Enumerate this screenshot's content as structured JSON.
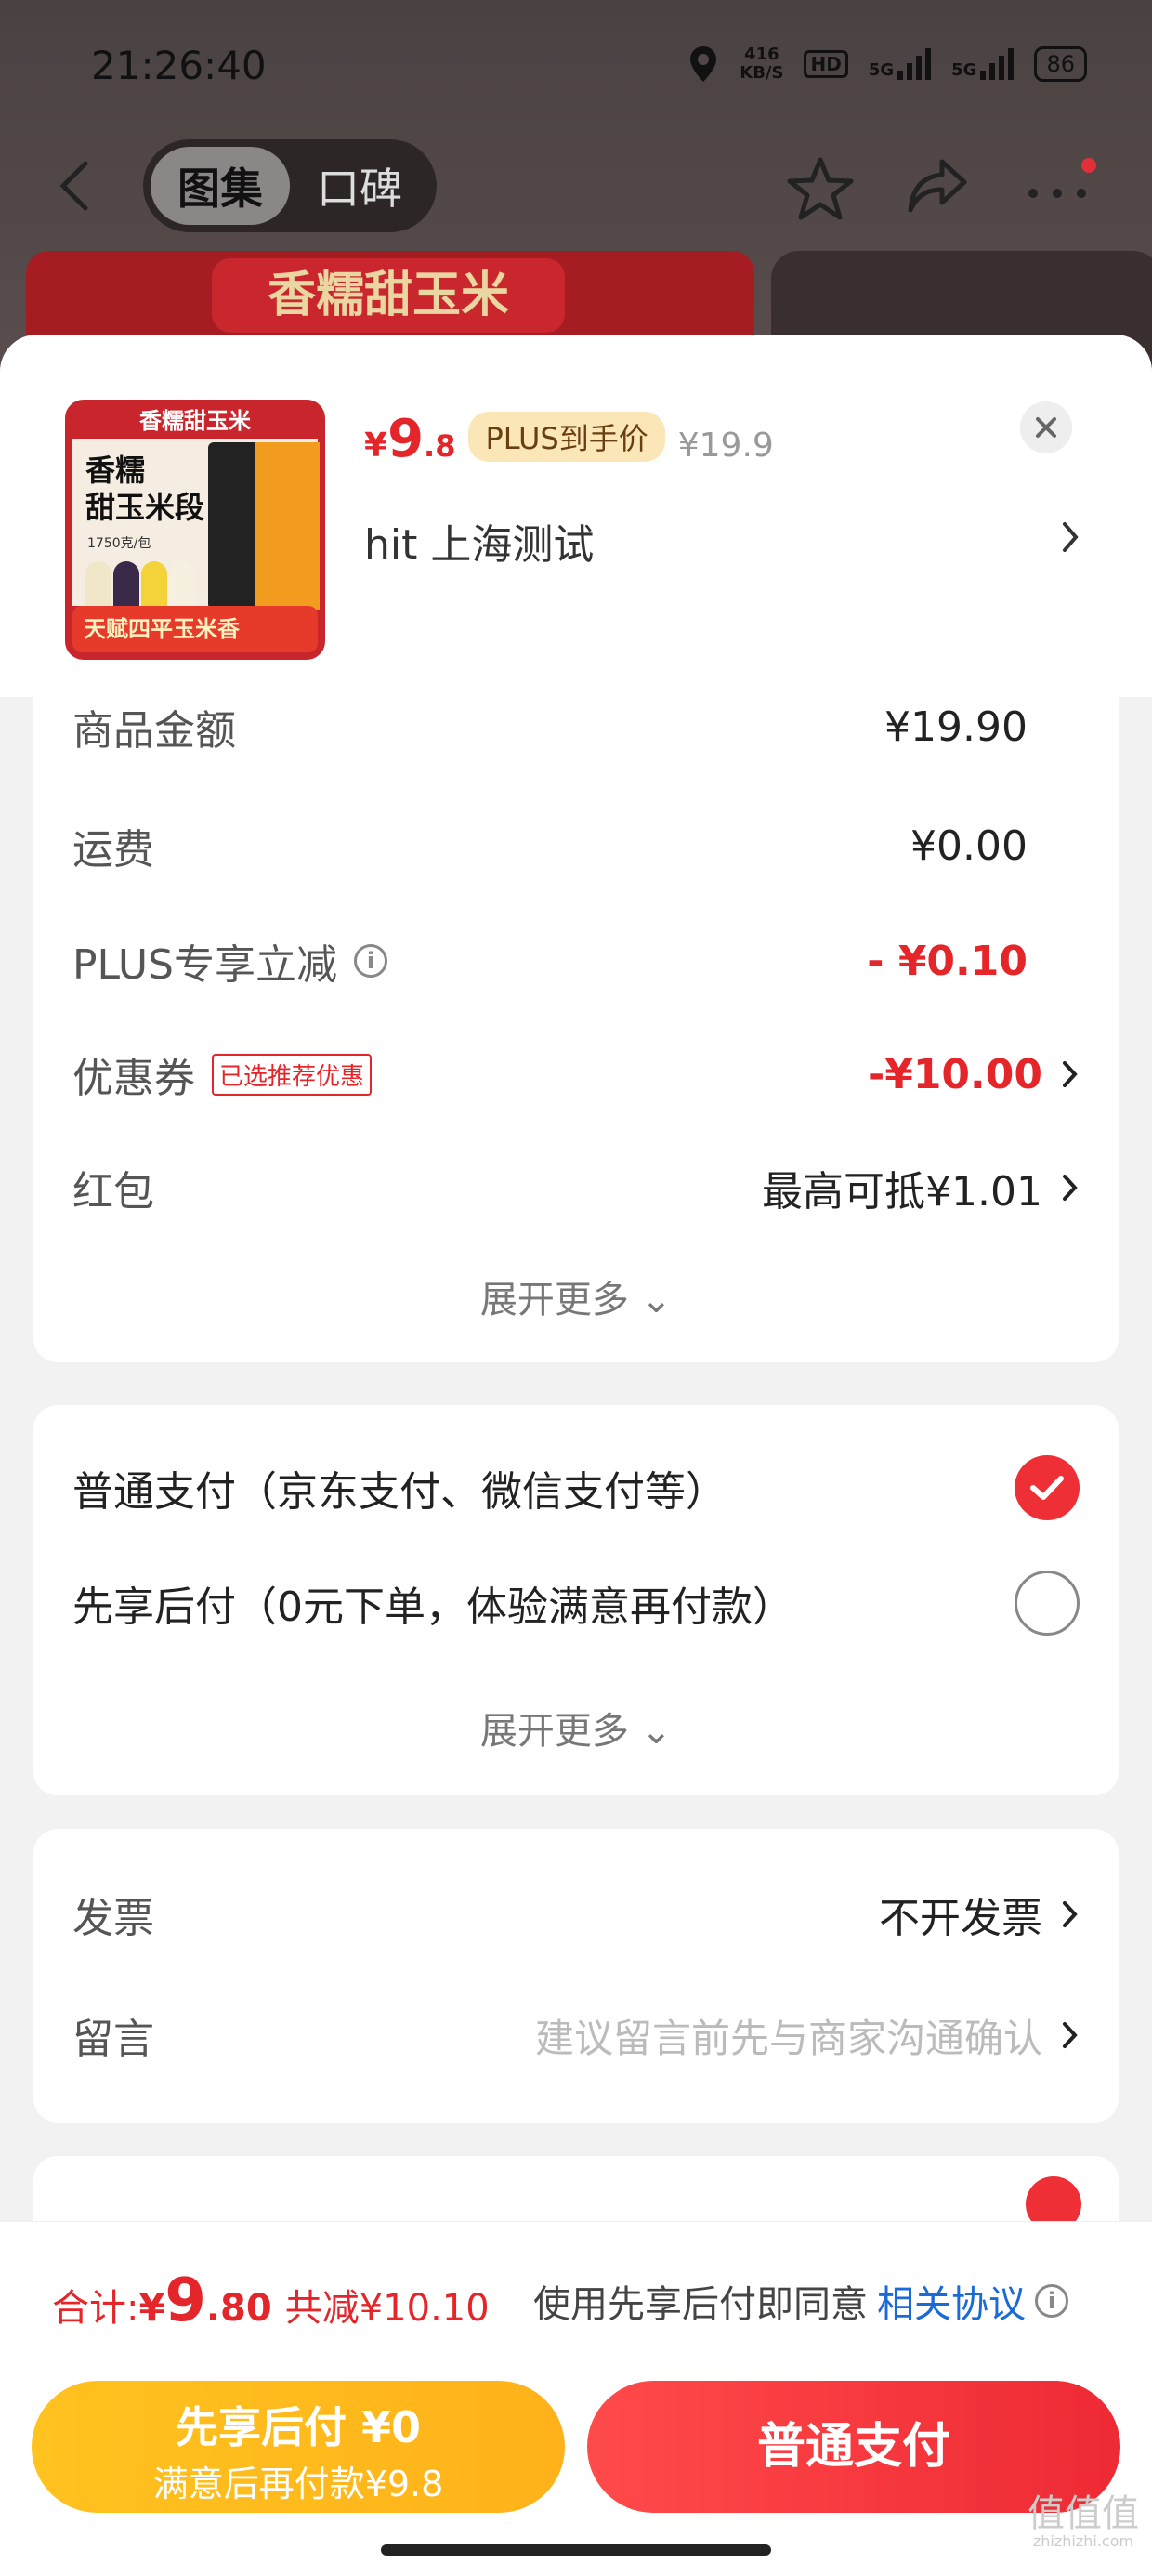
{
  "status_bar": {
    "time": "21:26:40",
    "net_speed": "416",
    "net_unit": "KB/S",
    "hd": "HD",
    "sig1": "5G",
    "sig2": "5G",
    "battery": "86"
  },
  "nav": {
    "tab_active": "图集",
    "tab_inactive": "口碑"
  },
  "background": {
    "banner_title": "香糯甜玉米"
  },
  "product": {
    "thumb_top": "香糯甜玉米",
    "thumb_name": "香糯\n甜玉米段",
    "thumb_spec": "1750克/包",
    "thumb_slogan": "天赋四平玉米香",
    "price_symbol": "¥",
    "price_int": "9",
    "price_dec": ".8",
    "plus_badge": "PLUS到手价",
    "original_price": "¥19.9",
    "address": "hit  上海测试"
  },
  "costs": {
    "rows": [
      {
        "label": "商品金额",
        "value": "¥19.90"
      },
      {
        "label": "运费",
        "value": "¥0.00"
      },
      {
        "label": "PLUS专享立减",
        "value": "- ¥0.10"
      },
      {
        "label": "优惠券",
        "tag": "已选推荐优惠",
        "value": "-¥10.00"
      },
      {
        "label": "红包",
        "value": "最高可抵¥1.01"
      }
    ],
    "expand": "展开更多"
  },
  "payment": {
    "options": [
      {
        "label": "普通支付（京东支付、微信支付等）",
        "selected": true
      },
      {
        "label": "先享后付（0元下单，体验满意再付款）",
        "selected": false
      }
    ],
    "expand": "展开更多"
  },
  "extras": {
    "invoice_label": "发票",
    "invoice_value": "不开发票",
    "note_label": "留言",
    "note_placeholder": "建议留言前先与商家沟通确认"
  },
  "summary": {
    "total_label": "合计: ",
    "total_symbol": "¥",
    "total_int": "9",
    "total_dec": ".80",
    "discount": "共减¥10.10",
    "agree_text": "使用先享后付即同意",
    "agree_link": "相关协议"
  },
  "buttons": {
    "pay_later_title": "先享后付 ¥0",
    "pay_later_sub": "满意后再付款¥9.8",
    "pay_normal": "普通支付"
  },
  "watermark": {
    "text": "值值值",
    "site": "zhizhizhi.com"
  },
  "colors": {
    "accent_red": "#e4262b",
    "link_blue": "#1a6ad8",
    "button_yellow": "#ffc21f"
  }
}
